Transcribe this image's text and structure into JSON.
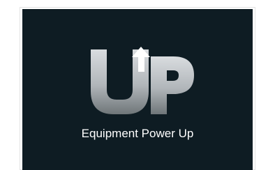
{
  "popup": {
    "logo_text": "UP",
    "caption": "Equipment Power Up"
  },
  "colors": {
    "background": "#0e1c23",
    "caption": "#ffffff",
    "logo_light": "#d6d9dc",
    "logo_dark": "#6f7679"
  },
  "icons": {
    "logo": "up-arrow-logo-icon"
  }
}
